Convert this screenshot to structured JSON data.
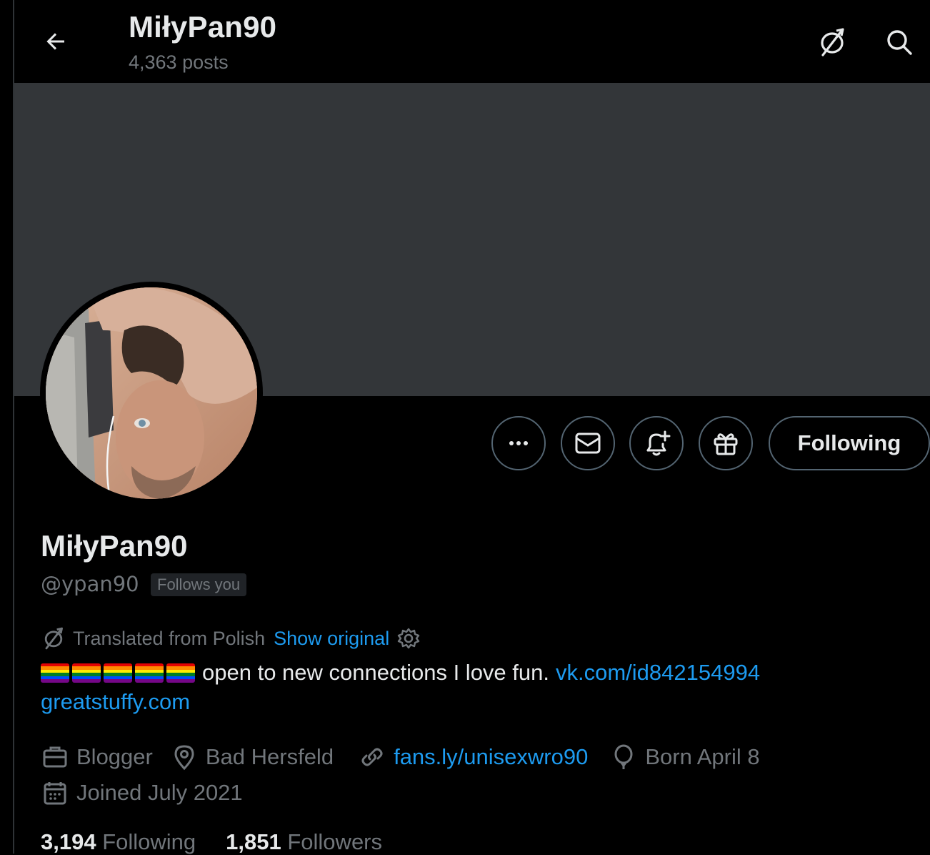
{
  "header": {
    "title": "MiłyPan90",
    "posts": "4,363 posts",
    "back_icon": "arrow-left-icon",
    "translate_icon": "translate-icon",
    "search_icon": "search-icon"
  },
  "profile": {
    "name": "MiłyPan90",
    "handle": "@ypan90",
    "follows_you": "Follows you",
    "follow_button": "Following",
    "translation_note": "Translated from Polish",
    "show_original": "Show original",
    "bio_text": "open to new connections I love fun.",
    "bio_link_1": "vk.com/id842154994",
    "bio_link_2": "greatstuffy.com",
    "rainbow_flags": 5,
    "category": "Blogger",
    "location": "Bad Hersfeld",
    "website": "fans.ly/unisexwro90",
    "birthday": "Born April 8",
    "joined": "Joined July 2021",
    "following_count": "3,194",
    "following_label": "Following",
    "followers_count": "1,851",
    "followers_label": "Followers"
  },
  "colors": {
    "background": "#000000",
    "banner": "#333639",
    "text": "#e7e9ea",
    "muted": "#71767b",
    "link": "#1d9bf0",
    "border": "#536471"
  },
  "actions": [
    "more-icon",
    "message-icon",
    "notify-icon",
    "gift-icon"
  ]
}
